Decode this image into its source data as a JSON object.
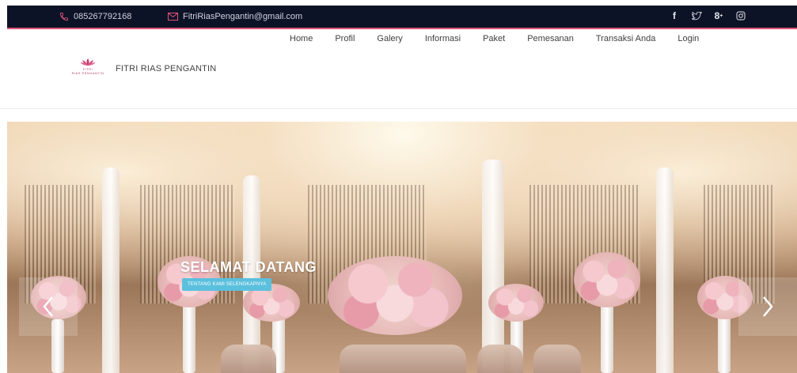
{
  "topbar": {
    "phone": "085267792168",
    "email": "FitriRiasPengantin@gmail.com",
    "social_icons": [
      "facebook-icon",
      "twitter-icon",
      "google-plus-icon",
      "instagram-icon"
    ],
    "background": "#0d1327",
    "accent": "#e2547a"
  },
  "nav": {
    "items": [
      {
        "label": "Home"
      },
      {
        "label": "Profil"
      },
      {
        "label": "Galery"
      },
      {
        "label": "Informasi"
      },
      {
        "label": "Paket"
      },
      {
        "label": "Pemesanan"
      },
      {
        "label": "Transaksi Anda"
      },
      {
        "label": "Login"
      }
    ]
  },
  "brand": {
    "logo_text": "FITRI",
    "logo_subtext": "RIAS PENGANTIN",
    "name": "FITRI RIAS PENGANTIN"
  },
  "hero": {
    "title": "SELAMAT DATANG",
    "button_label": "TENTANG KAMI SELENGKAPNYA",
    "button_color": "#5bc0de"
  }
}
